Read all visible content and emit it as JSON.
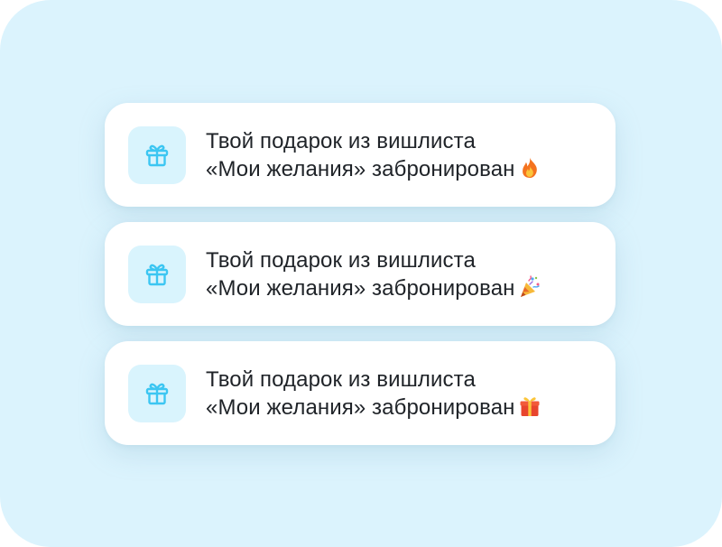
{
  "notifications": [
    {
      "line1": "Твой подарок из вишлиста",
      "line2": "«Мои желания» забронирован",
      "emoji": "fire-emoji"
    },
    {
      "line1": "Твой подарок из вишлиста",
      "line2": "«Мои желания» забронирован",
      "emoji": "party-popper-emoji"
    },
    {
      "line1": "Твой подарок из вишлиста",
      "line2": "«Мои желания» забронирован",
      "emoji": "wrapped-gift-emoji"
    }
  ],
  "colors": {
    "background": "#dbf3fd",
    "card": "#ffffff",
    "icon_tile": "#d9f4fd",
    "icon_stroke": "#3cc6f2",
    "text": "#1f2328"
  },
  "icon": "gift-icon"
}
